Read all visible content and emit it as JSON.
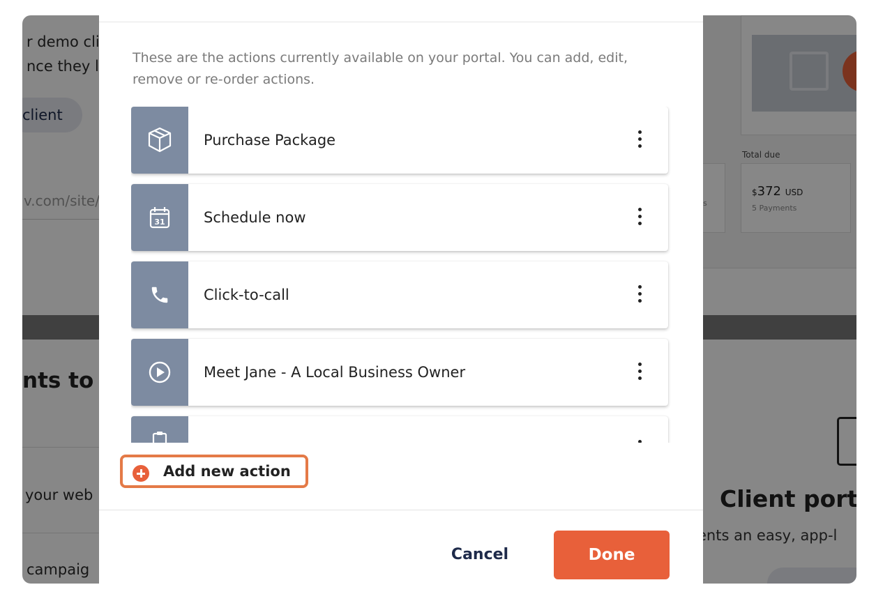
{
  "background": {
    "lines": [
      "r demo cli",
      "nce they l"
    ],
    "client_button": "client",
    "url_fragment": "v.com/site/",
    "heading_fragment": "nts to y",
    "row_text_1": "your web",
    "row_text_2": "campaig",
    "total_due_label": "Total due",
    "amount_currency": "$",
    "amount_value": "372",
    "amount_unit": "USD",
    "payments": "5 Payments",
    "side_small": "s",
    "client_portal_heading": "Client port",
    "client_portal_sub": "ents an easy, app-l"
  },
  "modal": {
    "description": "These are the actions currently available on your portal. You can add, edit, remove or re-order actions.",
    "actions": [
      {
        "label": "Purchase Package",
        "icon": "package-icon"
      },
      {
        "label": "Schedule now",
        "icon": "calendar-icon"
      },
      {
        "label": "Click-to-call",
        "icon": "phone-icon"
      },
      {
        "label": "Meet Jane - A Local Business Owner",
        "icon": "play-circle-icon"
      },
      {
        "label": "",
        "icon": "clipboard-icon"
      }
    ],
    "add_action_label": "Add new action",
    "cancel_label": "Cancel",
    "done_label": "Done"
  },
  "colors": {
    "accent": "#e8603a",
    "icon_tile": "#7d8ba1",
    "highlight_border": "#e47a47"
  }
}
